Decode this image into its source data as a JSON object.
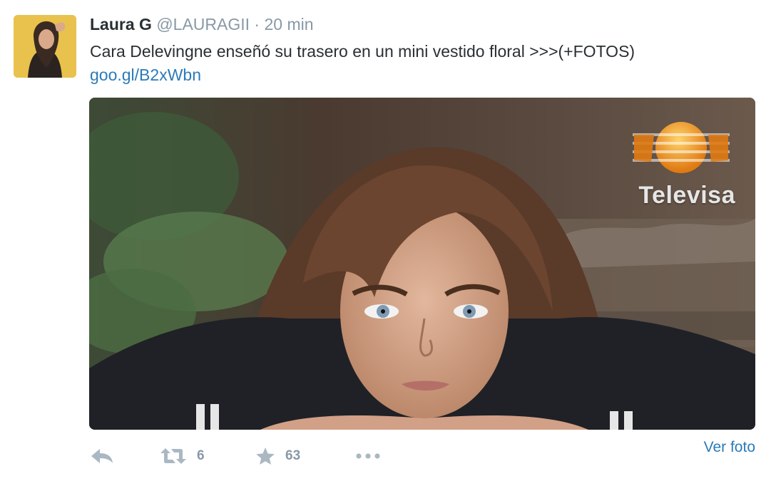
{
  "tweet": {
    "author_name": "Laura G",
    "handle": "@LAURAGII",
    "separator": "·",
    "time": "20 min",
    "text": "Cara Delevingne enseñó su trasero en un mini vestido floral >>>(+FOTOS)",
    "link": "goo.gl/B2xWbn"
  },
  "media": {
    "watermark": "Televisa",
    "logo_icon": "televisa-logo-icon"
  },
  "actions": {
    "reply_icon": "reply-icon",
    "retweet_icon": "retweet-icon",
    "retweet_count": "6",
    "favorite_icon": "star-icon",
    "favorite_count": "63",
    "more_icon": "more-icon",
    "view_photo": "Ver foto"
  },
  "colors": {
    "link": "#2b7bb9",
    "muted": "#8899a6",
    "icon": "#aab8c2",
    "text": "#292f33"
  }
}
